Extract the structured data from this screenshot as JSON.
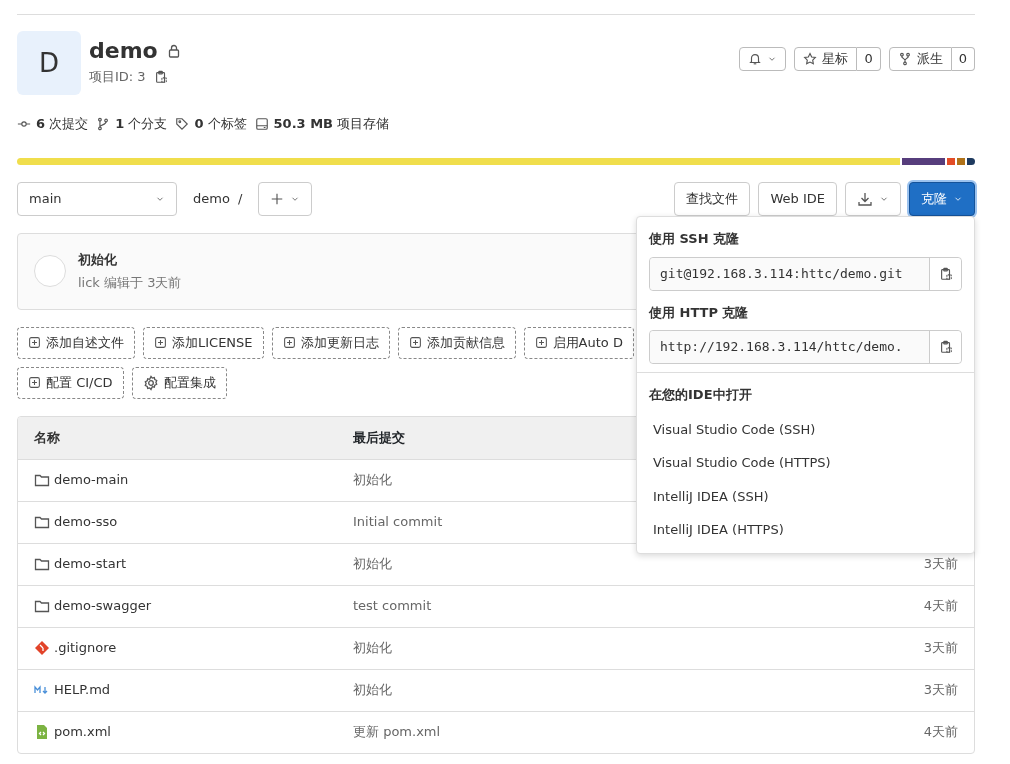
{
  "project": {
    "avatar_letter": "D",
    "name": "demo",
    "project_id": "项目ID: 3"
  },
  "actions": {
    "star_label": "星标",
    "star_count": "0",
    "fork_label": "派生",
    "fork_count": "0"
  },
  "stats": [
    {
      "kind": "commit",
      "number": "6",
      "label": "次提交"
    },
    {
      "kind": "branch",
      "number": "1",
      "label": "个分支"
    },
    {
      "kind": "tag",
      "number": "0",
      "label": "个标签"
    },
    {
      "kind": "storage",
      "number": "50.3 MB",
      "label": "项目存储"
    }
  ],
  "languages": [
    {
      "color": "#f0de4c"
    },
    {
      "color": "#563d7c"
    },
    {
      "color": "#e34c26"
    },
    {
      "color": "#b07219"
    },
    {
      "color": "#1e3a5f"
    }
  ],
  "toolbar": {
    "branch": "main",
    "path": "demo",
    "separator": "/",
    "find_file": "查找文件",
    "web_ide": "Web IDE",
    "clone": "克隆"
  },
  "last_commit": {
    "title": "初始化",
    "meta": "lick 编辑于 3天前"
  },
  "suggestions": [
    {
      "kind": "add",
      "label": "添加自述文件"
    },
    {
      "kind": "add",
      "label": "添加LICENSE"
    },
    {
      "kind": "add",
      "label": "添加更新日志"
    },
    {
      "kind": "add",
      "label": "添加贡献信息"
    },
    {
      "kind": "add",
      "label": "启用Auto D"
    },
    {
      "kind": "add",
      "label": "配置 CI/CD"
    },
    {
      "kind": "settings",
      "label": "配置集成"
    }
  ],
  "table": {
    "columns": [
      "名称",
      "最后提交"
    ],
    "rows": [
      {
        "kind": "folder",
        "name": "demo-main",
        "commit": "初始化"
      },
      {
        "kind": "folder",
        "name": "demo-sso",
        "commit": "Initial commit"
      },
      {
        "kind": "folder",
        "name": "demo-start",
        "commit": "初始化",
        "updated": "3天前"
      },
      {
        "kind": "folder",
        "name": "demo-swagger",
        "commit": "test commit",
        "updated": "4天前"
      },
      {
        "kind": "git",
        "name": ".gitignore",
        "commit": "初始化",
        "updated": "3天前"
      },
      {
        "kind": "markdown",
        "name": "HELP.md",
        "commit": "初始化",
        "updated": "3天前"
      },
      {
        "kind": "xml",
        "name": "pom.xml",
        "commit": "更新 pom.xml",
        "updated": "4天前"
      }
    ]
  },
  "clone_menu": {
    "ssh_label": "使用 SSH 克隆",
    "ssh_url": "git@192.168.3.114:httc/demo.git",
    "http_label": "使用 HTTP 克隆",
    "http_url": "http://192.168.3.114/httc/demo.",
    "ide_heading": "在您的IDE中打开",
    "ide_items": [
      "Visual Studio Code (SSH)",
      "Visual Studio Code (HTTPS)",
      "IntelliJ IDEA (SSH)",
      "IntelliJ IDEA (HTTPS)"
    ]
  }
}
